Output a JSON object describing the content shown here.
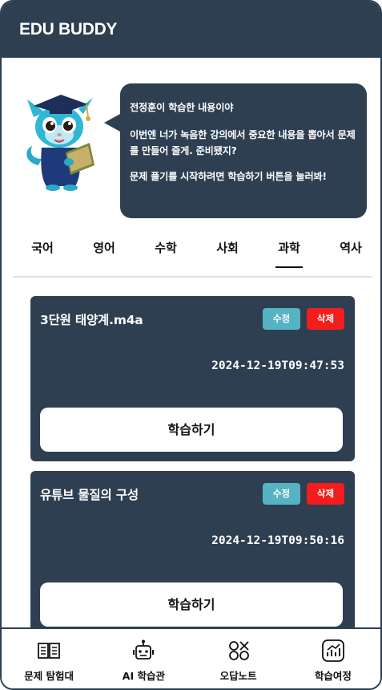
{
  "app": {
    "title": "EDU BUDDY"
  },
  "bubble": {
    "line1": "전정훈이 학습한 내용이야",
    "line2": "이번엔 너가 녹음한 강의에서 중요한 내용을 뽑아서 문제를 만들어 줄게. 준비됐지?",
    "line3": "문제 풀기를 시작하려면 학습하기 버튼을 눌러봐!"
  },
  "subjects": [
    {
      "label": "국어"
    },
    {
      "label": "영어"
    },
    {
      "label": "수학"
    },
    {
      "label": "사회"
    },
    {
      "label": "과학",
      "active": true
    },
    {
      "label": "역사"
    }
  ],
  "cards": [
    {
      "name": "3단원 태양계.m4a",
      "edit": "수정",
      "delete": "삭제",
      "date": "2024-12-19T09:47:53",
      "study": "학습하기"
    },
    {
      "name": "유튜브 물질의 구성",
      "edit": "수정",
      "delete": "삭제",
      "date": "2024-12-19T09:50:16",
      "study": "학습하기"
    }
  ],
  "nav": [
    {
      "label": "문제 탐험대",
      "icon": "book-icon"
    },
    {
      "label": "AI 학습관",
      "icon": "robot-icon"
    },
    {
      "label": "오답노트",
      "icon": "ox-icon"
    },
    {
      "label": "학습여정",
      "icon": "chart-icon"
    }
  ],
  "colors": {
    "primary": "#2e3f52",
    "edit": "#56b3c4",
    "delete": "#f21d1d"
  }
}
